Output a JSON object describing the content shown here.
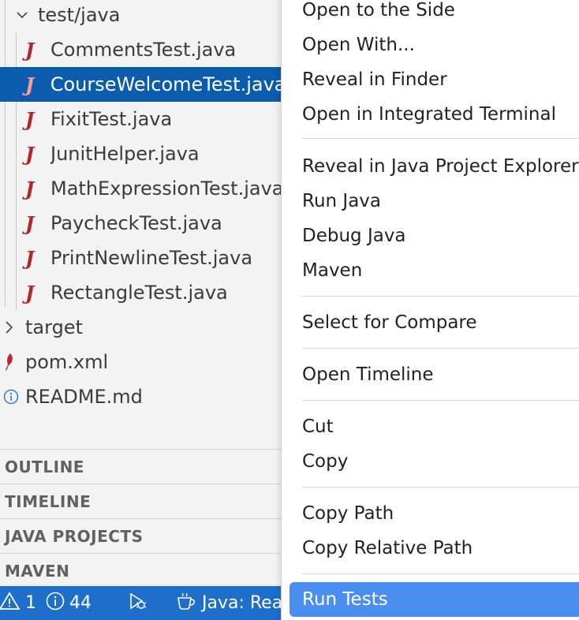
{
  "explorer": {
    "folder": {
      "label": "test/java"
    },
    "files": [
      {
        "label": "CommentsTest.java"
      },
      {
        "label": "CourseWelcomeTest.java"
      },
      {
        "label": "FixitTest.java"
      },
      {
        "label": "JunitHelper.java"
      },
      {
        "label": "MathExpressionTest.java"
      },
      {
        "label": "PaycheckTest.java"
      },
      {
        "label": "PrintNewlineTest.java"
      },
      {
        "label": "RectangleTest.java"
      }
    ],
    "selected_file": "CourseWelcomeTest.java",
    "root_items": [
      {
        "label": "target",
        "icon": "chevron-right-icon"
      },
      {
        "label": "pom.xml",
        "icon": "maven-feather-icon"
      },
      {
        "label": "README.md",
        "icon": "info-icon"
      }
    ]
  },
  "sections": [
    "OUTLINE",
    "TIMELINE",
    "JAVA PROJECTS",
    "MAVEN"
  ],
  "statusbar": {
    "warnings": "1",
    "infos": "44",
    "java_status": "Java: Rea"
  },
  "context_menu": {
    "items": [
      "Open to the Side",
      "Open With...",
      "Reveal in Finder",
      "Open in Integrated Terminal",
      "Reveal in Java Project Explorer",
      "Run Java",
      "Debug Java",
      "Maven",
      "Select for Compare",
      "Open Timeline",
      "Cut",
      "Copy",
      "Copy Path",
      "Copy Relative Path",
      "Run Tests"
    ],
    "highlighted": "Run Tests"
  },
  "colors": {
    "selection": "#0b5cad",
    "statusbar": "#1e6fcc",
    "menu_highlight": "#4a8ff0",
    "java_icon": "#b0282d"
  }
}
